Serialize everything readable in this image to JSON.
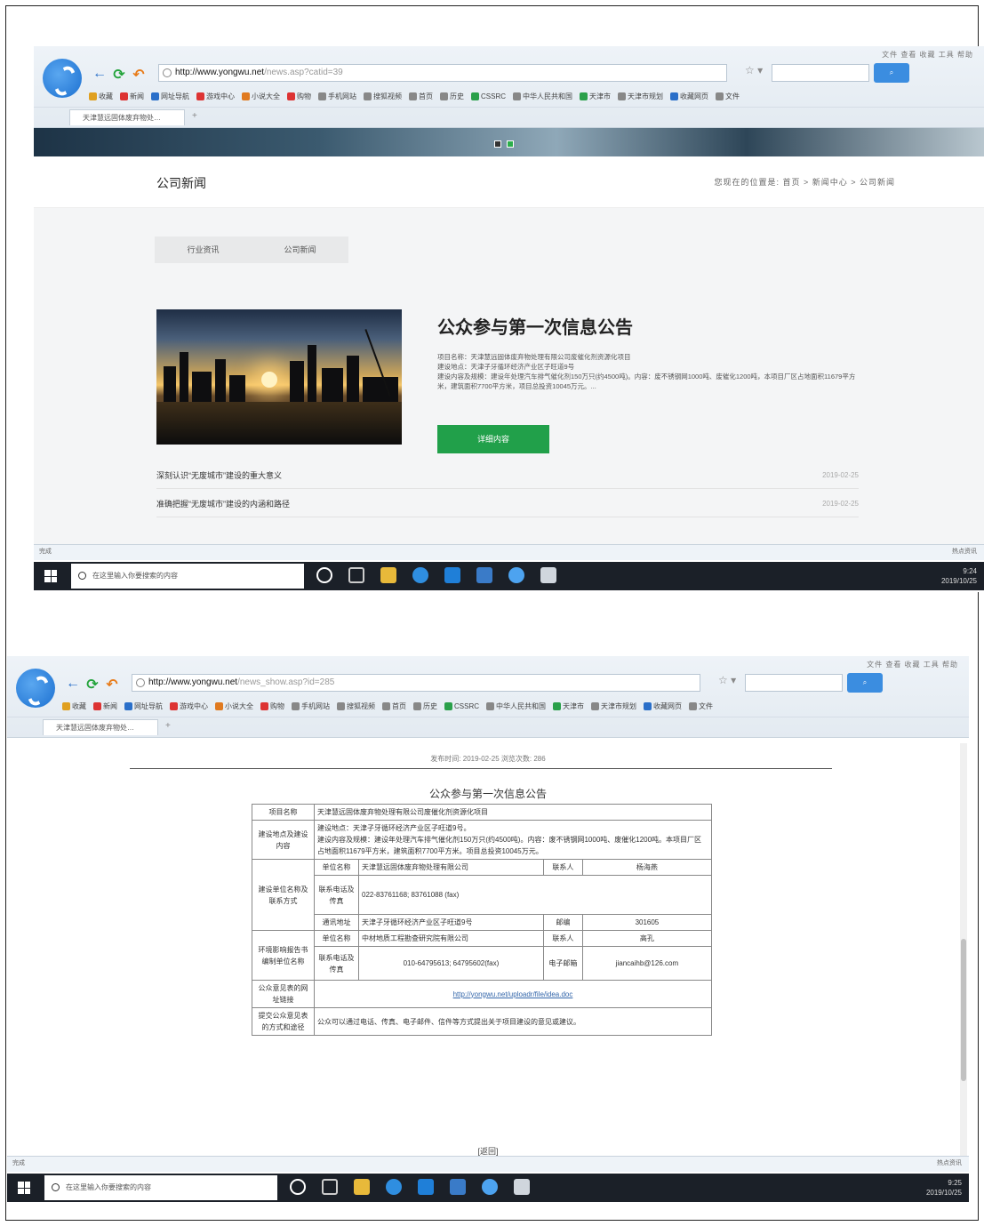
{
  "shot1": {
    "browser": {
      "url_host": "http://www.yongwu.net",
      "url_path": "/news.asp?catid=39",
      "tab_label": "天津慧远固体废弃物处…",
      "search_placeholder": "",
      "menu": "文件 查看 收藏 工具 帮助",
      "bookmarks": [
        "收藏",
        "新闻",
        "网址导航",
        "游戏中心",
        "小说大全",
        "购物",
        "手机网站",
        "搜狐视频",
        "首页",
        "历史",
        "CSSRC",
        "中华人民共和国",
        "天津市",
        "天津市规划",
        "收藏网页",
        "文件"
      ]
    },
    "page": {
      "section_title": "公司新闻",
      "breadcrumb": "您现在的位置是: 首页 > 新闻中心 > 公司新闻",
      "tabs": [
        "行业资讯",
        "公司新闻"
      ],
      "feature": {
        "title": "公众参与第一次信息公告",
        "lines": [
          "项目名称：天津慧远固体废弃物处理有限公司废催化剂资源化项目",
          "建设地点：天津子牙循环经济产业区子旺道9号",
          "建设内容及规模：建设年处理汽车排气催化剂150万只(约4500吨)。内容：废不锈钢网1000吨、废催化1200吨，本项目厂区占地面积11679平方米，建筑面积7700平方米，项目总投资10045万元。..."
        ],
        "button": "详细内容"
      },
      "news": [
        {
          "title": "深刻认识“无废城市”建设的重大意义",
          "date": "2019-02-25"
        },
        {
          "title": "准确把握“无废城市”建设的内涵和路径",
          "date": "2019-02-25"
        }
      ],
      "status_left": "完成",
      "status_right": "热点资讯"
    },
    "taskbar": {
      "search_placeholder": "在这里输入你要搜索的内容",
      "time": "9:24",
      "date": "2019/10/25"
    }
  },
  "shot2": {
    "browser": {
      "url_host": "http://www.yongwu.net",
      "url_path": "/news_show.asp?id=285",
      "tab_label": "天津慧远固体废弃物处…",
      "menu": "文件 查看 收藏 工具 帮助",
      "bookmarks": [
        "收藏",
        "新闻",
        "网址导航",
        "游戏中心",
        "小说大全",
        "购物",
        "手机网站",
        "搜狐视频",
        "首页",
        "历史",
        "CSSRC",
        "中华人民共和国",
        "天津市",
        "天津市规划",
        "收藏网页",
        "文件"
      ]
    },
    "page": {
      "meta": "发布时间: 2019-02-25  浏览次数: 286",
      "doc_title": "公众参与第一次信息公告",
      "table": {
        "project_name_label": "项目名称",
        "project_name": "天津慧远固体废弃物处理有限公司废催化剂资源化项目",
        "location_label": "建设地点及建设内容",
        "location": "建设地点：天津子牙循环经济产业区子旺道9号。",
        "content": "建设内容及规模：建设年处理汽车排气催化剂150万只(约4500吨)。内容：废不锈钢网1000吨、废催化1200吨。本项目厂区占地面积11679平方米，建筑面积7700平方米。项目总投资10045万元。",
        "builder_label": "建设单位名称及联系方式",
        "unit_name_label": "单位名称",
        "unit_name": "天津慧远固体废弃物处理有限公司",
        "contact_label": "联系人",
        "contact": "杨海燕",
        "phone_label": "联系电话及传真",
        "phone": "022-83761168; 83761088 (fax)",
        "address_label": "通讯地址",
        "address": "天津子牙循环经济产业区子旺道9号",
        "zip_label": "邮编",
        "zip": "301605",
        "eia_label": "环境影响报告书编制单位名称",
        "eia_unit_label": "单位名称",
        "eia_unit": "中材地质工程勘查研究院有限公司",
        "eia_contact_label": "联系人",
        "eia_contact": "高孔",
        "eia_phone_label": "联系电话及传真",
        "eia_phone": "010-64795613; 64795602(fax)",
        "email_label": "电子邮箱",
        "email": "jiancaihb@126.com",
        "opinion_link_label": "公众意见表的网址链接",
        "opinion_link": "http://yongwu.net/uploadr/file/idea.doc",
        "submit_label": "提交公众意见表的方式和途径",
        "submit": "公众可以通过电话、传真、电子邮件、信件等方式提出关于项目建设的意见或建议。"
      },
      "return_text": "[返回]",
      "status_left": "完成",
      "status_right": "热点资讯"
    },
    "taskbar": {
      "search_placeholder": "在这里输入你要搜索的内容",
      "time": "9:25",
      "date": "2019/10/25"
    }
  }
}
